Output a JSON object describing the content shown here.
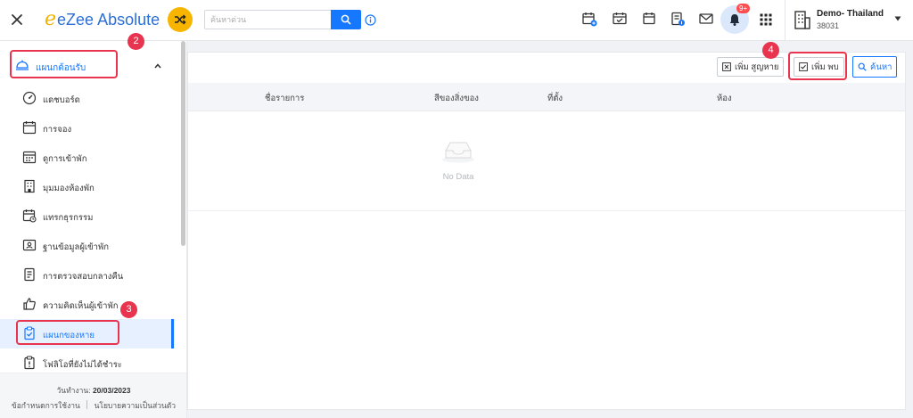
{
  "app": {
    "logo_letter": "e",
    "logo_text": "eZee Absolute"
  },
  "header": {
    "search_placeholder": "ค้นหาด่วน",
    "notification_badge": "9+",
    "property_name": "Demo- Thailand",
    "property_id": "38031"
  },
  "sidebar": {
    "section_label": "แผนกต้อนรับ",
    "items": [
      {
        "label": "แดชบอร์ด"
      },
      {
        "label": "การจอง"
      },
      {
        "label": "ดูการเข้าพัก"
      },
      {
        "label": "มุมมองห้องพัก"
      },
      {
        "label": "แทรกธุรกรรม"
      },
      {
        "label": "ฐานข้อมูลผู้เข้าพัก"
      },
      {
        "label": "การตรวจสอบกลางคืน"
      },
      {
        "label": "ความคิดเห็นผู้เข้าพัก"
      },
      {
        "label": "แผนกของหาย"
      },
      {
        "label": "โฟลิโอที่ยังไม่ได้ชำระ"
      }
    ],
    "active_index": 8,
    "footer": {
      "date_label": "วันทำงาน:",
      "date_value": "20/03/2023",
      "terms_link": "ข้อกำหนดการใช้งาน",
      "privacy_link": "นโยบายความเป็นส่วนตัว"
    }
  },
  "toolbar": {
    "add_lost_label": "เพิ่ม สูญหาย",
    "add_found_label": "เพิ่ม พบ",
    "search_label": "ค้นหา"
  },
  "table": {
    "columns": [
      "ชื่อรายการ",
      "สีของสิ่งของ",
      "ที่ตั้ง",
      "ห้อง"
    ],
    "empty_text": "No Data"
  },
  "annotations": [
    "2",
    "3",
    "4"
  ],
  "colors": {
    "primary": "#1677ff",
    "accent_yellow": "#f7b500",
    "highlight_red": "#e8344e"
  }
}
